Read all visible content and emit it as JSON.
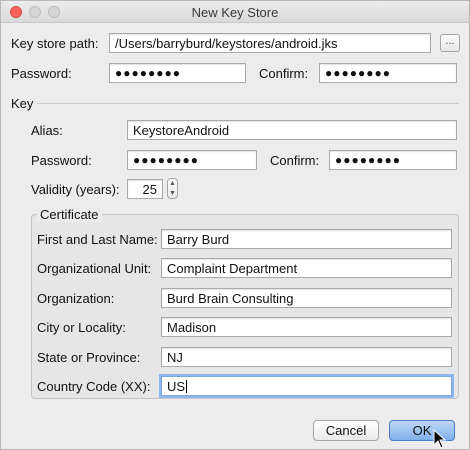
{
  "window": {
    "title": "New Key Store"
  },
  "keystore": {
    "path_label": "Key store path:",
    "path_value": "/Users/barryburd/keystores/android.jks",
    "browse_label": "...",
    "password_label": "Password:",
    "password_value": "●●●●●●●●",
    "confirm_label": "Confirm:",
    "confirm_value": "●●●●●●●●"
  },
  "key": {
    "section_label": "Key",
    "alias_label": "Alias:",
    "alias_value": "KeystoreAndroid",
    "password_label": "Password:",
    "password_value": "●●●●●●●●",
    "confirm_label": "Confirm:",
    "confirm_value": "●●●●●●●●",
    "validity_label": "Validity (years):",
    "validity_value": "25"
  },
  "certificate": {
    "section_label": "Certificate",
    "name_label": "First and Last Name:",
    "name_value": "Barry Burd",
    "unit_label": "Organizational Unit:",
    "unit_value": "Complaint Department",
    "org_label": "Organization:",
    "org_value": "Burd Brain Consulting",
    "city_label": "City or Locality:",
    "city_value": "Madison",
    "state_label": "State or Province:",
    "state_value": "NJ",
    "country_label": "Country Code (XX):",
    "country_value": "US"
  },
  "buttons": {
    "cancel_label": "Cancel",
    "ok_label": "OK"
  },
  "colors": {
    "close_button": "#fc605c",
    "default_button": "#7fb0ec",
    "focus_ring": "#8fb7ef"
  }
}
